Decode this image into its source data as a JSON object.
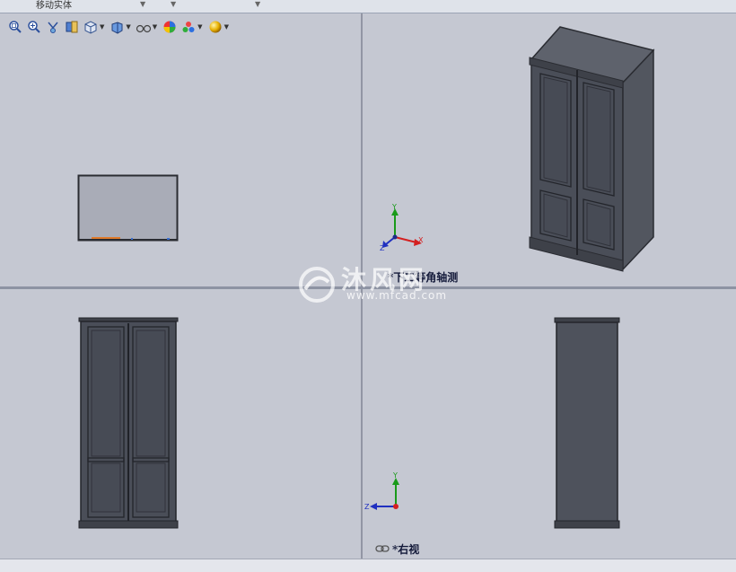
{
  "toolbar": {
    "command": "移动实体"
  },
  "heads_up_toolbar": [
    {
      "icon": "zoom-to-fit-icon"
    },
    {
      "icon": "zoom-to-area-icon"
    },
    {
      "icon": "previous-view-icon"
    },
    {
      "icon": "section-view-icon"
    },
    {
      "icon": "view-orientation-icon"
    },
    {
      "icon": "display-style-icon"
    },
    {
      "icon": "hide-show-items-icon"
    },
    {
      "icon": "edit-appearance-icon"
    },
    {
      "icon": "apply-scene-icon"
    },
    {
      "icon": "view-settings-icon"
    }
  ],
  "viewports": {
    "top_right": {
      "label": "*下二等角轴测"
    },
    "bottom_right": {
      "label": "*右视"
    }
  },
  "triad_axes": {
    "x": "X",
    "y": "Y",
    "z": "Z"
  },
  "watermark": {
    "text": "沐风网",
    "url": "www.mfcad.com"
  },
  "colors": {
    "viewport_bg": "#c5c8d2",
    "model_dark": "#4e525c",
    "model_edge": "#2a2c32",
    "axis_x": "#d42020",
    "axis_y": "#1a9a1a",
    "axis_z": "#2030c0"
  }
}
